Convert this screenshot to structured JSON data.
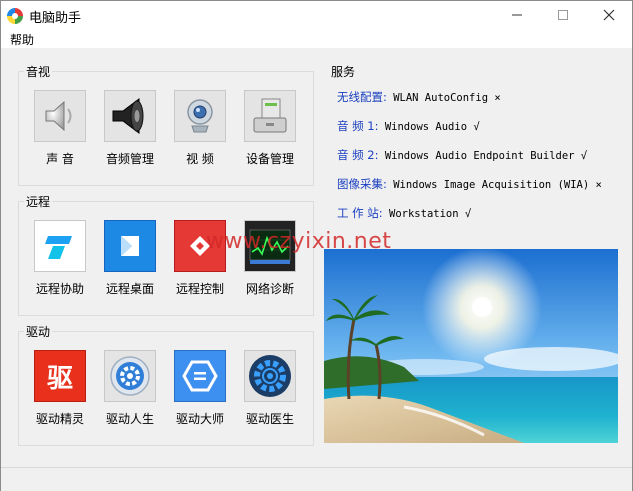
{
  "window": {
    "title": "电脑助手"
  },
  "menu": {
    "help": "帮助"
  },
  "av_group": {
    "title": "音视",
    "items": [
      {
        "label": "声  音",
        "icon": "speaker-icon"
      },
      {
        "label": "音频管理",
        "icon": "loudspeaker-icon"
      },
      {
        "label": "视  频",
        "icon": "webcam-icon"
      },
      {
        "label": "设备管理",
        "icon": "device-manager-icon"
      }
    ]
  },
  "remote_group": {
    "title": "远程",
    "items": [
      {
        "label": "远程协助",
        "icon": "remote-assist-icon"
      },
      {
        "label": "远程桌面",
        "icon": "remote-desktop-icon"
      },
      {
        "label": "远程控制",
        "icon": "remote-control-icon"
      },
      {
        "label": "网络诊断",
        "icon": "network-monitor-icon"
      }
    ]
  },
  "driver_group": {
    "title": "驱动",
    "items": [
      {
        "label": "驱动精灵",
        "icon": "driver-genius-icon",
        "glyph": "驱"
      },
      {
        "label": "驱动人生",
        "icon": "driver-life-icon"
      },
      {
        "label": "驱动大师",
        "icon": "driver-master-icon"
      },
      {
        "label": "驱动医生",
        "icon": "driver-doctor-icon"
      }
    ]
  },
  "services": {
    "title": "服务",
    "rows": [
      {
        "key": "无线配置:",
        "value": "WLAN AutoConfig ×"
      },
      {
        "key": "音  频 1:",
        "value": "Windows Audio √"
      },
      {
        "key": "音  频 2:",
        "value": "Windows Audio Endpoint Builder √"
      },
      {
        "key": "图像采集:",
        "value": "Windows Image Acquisition (WIA) ×"
      },
      {
        "key": "工 作 站:",
        "value": "Workstation √"
      }
    ]
  },
  "watermark": "www.czyixin.net",
  "colors": {
    "service_key": "#1a3fc0",
    "watermark": "#d22828"
  }
}
